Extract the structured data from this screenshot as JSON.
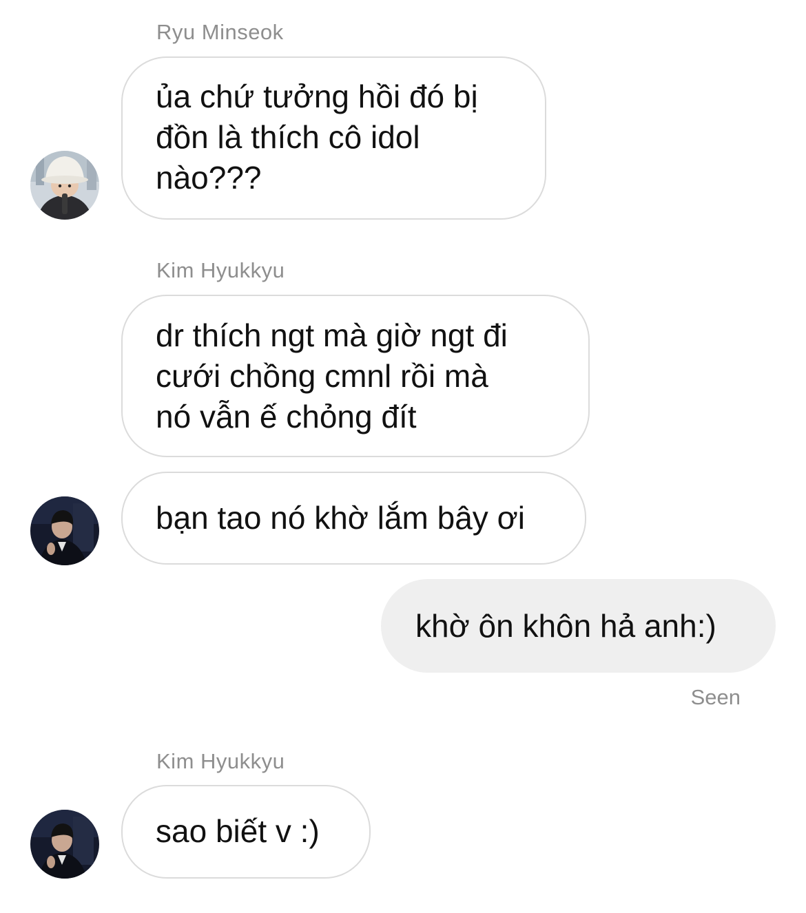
{
  "thread": {
    "groups": [
      {
        "sender": "Ryu Minseok",
        "avatar_icon": "avatar-ryu-minseok",
        "messages": [
          {
            "lines": [
              "ủa chứ tưởng hồi đó bị",
              "đồn là thích cô idol",
              "nào???"
            ]
          }
        ]
      },
      {
        "sender": "Kim Hyukkyu",
        "avatar_icon": "avatar-kim-hyukkyu",
        "messages": [
          {
            "lines": [
              "dr thích ngt mà giờ ngt đi",
              "cưới chồng cmnl rồi mà",
              "nó vẫn ế chỏng đít"
            ]
          },
          {
            "lines": [
              "bạn tao nó khờ lắm bây ơi"
            ]
          }
        ]
      }
    ],
    "my_message": {
      "text": "khờ ôn khôn hả anh:)"
    },
    "seen_label": "Seen",
    "last_group": {
      "sender": "Kim Hyukkyu",
      "avatar_icon": "avatar-kim-hyukkyu",
      "messages": [
        {
          "text": "sao biết v :)"
        }
      ]
    }
  },
  "colors": {
    "incoming_border": "#dbdbdb",
    "outgoing_bg": "#efefef",
    "meta_text": "#8e8e8e",
    "message_text": "#111111"
  }
}
